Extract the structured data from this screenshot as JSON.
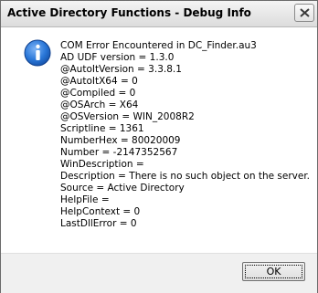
{
  "window": {
    "title": "Active Directory Functions - Debug Info"
  },
  "icon": {
    "name": "information-icon",
    "color": "#1a6ad2"
  },
  "message": {
    "lines": [
      "COM Error Encountered in DC_Finder.au3",
      "AD UDF version = 1.3.0",
      "@AutoItVersion = 3.3.8.1",
      "@AutoItX64 = 0",
      "@Compiled = 0",
      "@OSArch = X64",
      "@OSVersion = WIN_2008R2",
      "Scriptline = 1361",
      "NumberHex = 80020009",
      "Number = -2147352567",
      "WinDescription =",
      "Description = There is no such object on the server.",
      "Source = Active Directory",
      "HelpFile =",
      "HelpContext = 0",
      "LastDllError = 0"
    ]
  },
  "buttons": {
    "ok_label": "OK"
  }
}
